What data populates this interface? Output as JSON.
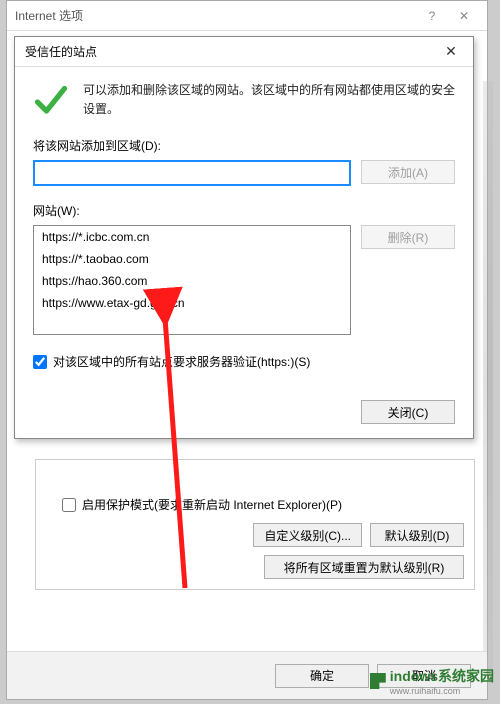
{
  "parent": {
    "title": "Internet 选项",
    "protect_label": "启用保护模式(要求重新启动 Internet Explorer)(P)",
    "custom_level": "自定义级别(C)...",
    "default_level": "默认级别(D)",
    "reset_all": "将所有区域重置为默认级别(R)",
    "ok": "确定",
    "cancel": "取消"
  },
  "dialog": {
    "title": "受信任的站点",
    "info": "可以添加和删除该区域的网站。该区域中的所有网站都使用区域的安全设置。",
    "add_label": "将该网站添加到区域(D):",
    "add_btn": "添加(A)",
    "sites_label": "网站(W):",
    "remove_btn": "删除(R)",
    "verify_label": "对该区域中的所有站点要求服务器验证(https:)(S)",
    "close_btn": "关闭(C)",
    "sites": [
      "https://*.icbc.com.cn",
      "https://*.taobao.com",
      "https://hao.360.com",
      "https://www.etax-gd.gov.cn"
    ]
  },
  "watermark": {
    "brand": "indows系统家园",
    "url": "www.ruihaifu.com"
  }
}
